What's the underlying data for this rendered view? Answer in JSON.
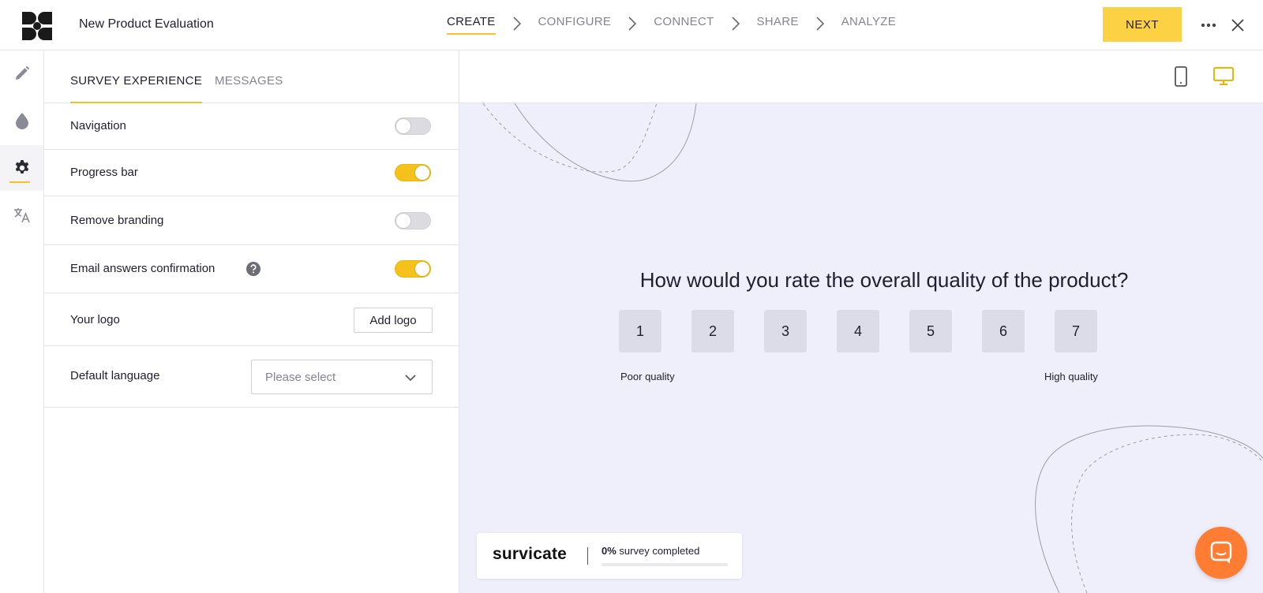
{
  "header": {
    "title": "New Product Evaluation",
    "steps": [
      {
        "label": "CREATE",
        "active": true
      },
      {
        "label": "CONFIGURE",
        "active": false
      },
      {
        "label": "CONNECT",
        "active": false
      },
      {
        "label": "SHARE",
        "active": false
      },
      {
        "label": "ANALYZE",
        "active": false
      }
    ],
    "next_label": "NEXT",
    "accent_color": "#fcd144"
  },
  "rail": {
    "items": [
      {
        "icon": "pencil-icon",
        "active": false
      },
      {
        "icon": "droplet-icon",
        "active": false
      },
      {
        "icon": "gear-icon",
        "active": true
      },
      {
        "icon": "translate-icon",
        "active": false
      }
    ]
  },
  "panel": {
    "tabs": [
      {
        "label": "SURVEY EXPERIENCE",
        "active": true
      },
      {
        "label": "MESSAGES",
        "active": false
      }
    ],
    "settings": [
      {
        "label": "Navigation",
        "type": "toggle",
        "on": false
      },
      {
        "label": "Progress bar",
        "type": "toggle",
        "on": true
      },
      {
        "label": "Remove branding",
        "type": "toggle",
        "on": false
      },
      {
        "label": "Email answers confirmation",
        "type": "toggle",
        "on": true,
        "help_icon": "question-circle-icon"
      },
      {
        "label": "Your logo",
        "type": "button",
        "button_label": "Add logo"
      },
      {
        "label": "Default language",
        "type": "select",
        "placeholder": "Please select"
      }
    ]
  },
  "preview": {
    "question": "How would you rate the overall quality of the product?",
    "scale": [
      "1",
      "2",
      "3",
      "4",
      "5",
      "6",
      "7"
    ],
    "low_label": "Poor quality",
    "high_label": "High quality",
    "brand": "survicate",
    "progress_percent": "0%",
    "progress_text": "survey completed",
    "progress_value": 0,
    "device_modes": [
      "mobile-icon",
      "desktop-icon"
    ],
    "active_device": "desktop-icon",
    "background_color": "#efeefb",
    "chat_color": "#ff7d33"
  }
}
